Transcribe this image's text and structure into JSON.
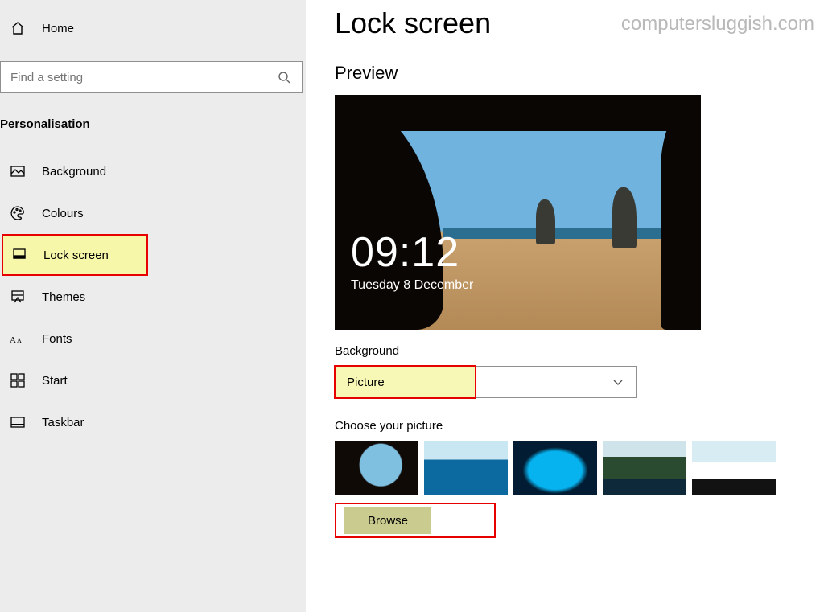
{
  "watermark": "computersluggish.com",
  "sidebar": {
    "home_label": "Home",
    "search_placeholder": "Find a setting",
    "category": "Personalisation",
    "items": [
      {
        "label": "Background",
        "icon": "image-icon"
      },
      {
        "label": "Colours",
        "icon": "palette-icon"
      },
      {
        "label": "Lock screen",
        "icon": "lockscreen-icon"
      },
      {
        "label": "Themes",
        "icon": "themes-icon"
      },
      {
        "label": "Fonts",
        "icon": "fonts-icon"
      },
      {
        "label": "Start",
        "icon": "start-icon"
      },
      {
        "label": "Taskbar",
        "icon": "taskbar-icon"
      }
    ],
    "selected_index": 2
  },
  "page": {
    "title": "Lock screen",
    "preview_heading": "Preview",
    "lock_time": "09:12",
    "lock_date": "Tuesday 8 December",
    "background_label": "Background",
    "background_dropdown_value": "Picture",
    "choose_picture_label": "Choose your picture",
    "browse_label": "Browse",
    "thumbnails": [
      "cave-beach",
      "ocean-surface",
      "ice-cave",
      "mountain-lake",
      "misty-hill"
    ]
  }
}
